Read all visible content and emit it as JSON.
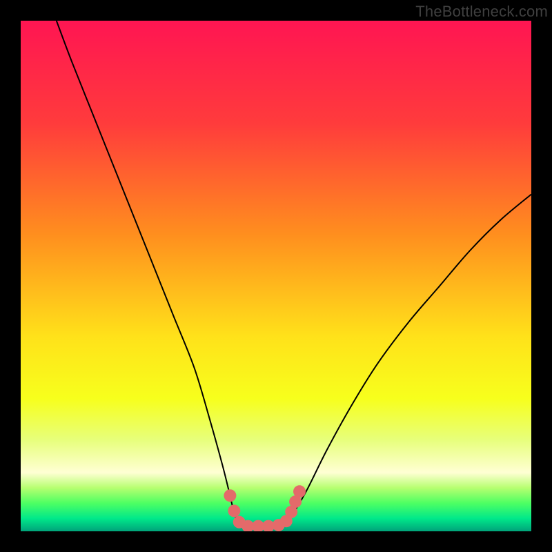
{
  "watermark": {
    "text": "TheBottleneck.com"
  },
  "chart_data": {
    "type": "line",
    "title": "",
    "xlabel": "",
    "ylabel": "",
    "xlim": [
      0,
      100
    ],
    "ylim": [
      0,
      100
    ],
    "series": [
      {
        "name": "curve",
        "x": [
          7,
          10,
          14,
          18,
          22,
          26,
          30,
          34,
          37,
          39.5,
          41,
          42,
          43.5,
          45,
          48,
          51,
          53,
          56,
          60,
          65,
          70,
          76,
          82,
          88,
          94,
          100
        ],
        "y": [
          100,
          92,
          82,
          72,
          62,
          52,
          42,
          32,
          22,
          13,
          7,
          3,
          1,
          1,
          1,
          1,
          3,
          8,
          16,
          25,
          33,
          41,
          48,
          55,
          61,
          66
        ]
      }
    ],
    "markers": {
      "name": "highlight-dots",
      "color": "#e46a6a",
      "radius_px": 9,
      "points": [
        {
          "x": 41.0,
          "y": 7.0
        },
        {
          "x": 41.8,
          "y": 4.0
        },
        {
          "x": 42.8,
          "y": 1.8
        },
        {
          "x": 44.5,
          "y": 1.0
        },
        {
          "x": 46.5,
          "y": 1.0
        },
        {
          "x": 48.5,
          "y": 1.0
        },
        {
          "x": 50.5,
          "y": 1.2
        },
        {
          "x": 52.0,
          "y": 2.0
        },
        {
          "x": 53.0,
          "y": 3.8
        },
        {
          "x": 53.8,
          "y": 5.8
        },
        {
          "x": 54.6,
          "y": 7.8
        }
      ]
    },
    "background_gradient": {
      "stops": [
        {
          "pos": 0.0,
          "color": "#ff1552"
        },
        {
          "pos": 0.2,
          "color": "#ff3b3c"
        },
        {
          "pos": 0.42,
          "color": "#ff8f1e"
        },
        {
          "pos": 0.62,
          "color": "#ffe21a"
        },
        {
          "pos": 0.74,
          "color": "#f7ff1c"
        },
        {
          "pos": 0.82,
          "color": "#e7ff7a"
        },
        {
          "pos": 0.885,
          "color": "#ffffd4"
        },
        {
          "pos": 0.915,
          "color": "#b6ff70"
        },
        {
          "pos": 0.945,
          "color": "#4dff63"
        },
        {
          "pos": 0.975,
          "color": "#00e88a"
        },
        {
          "pos": 1.0,
          "color": "#00a37a"
        }
      ]
    }
  }
}
